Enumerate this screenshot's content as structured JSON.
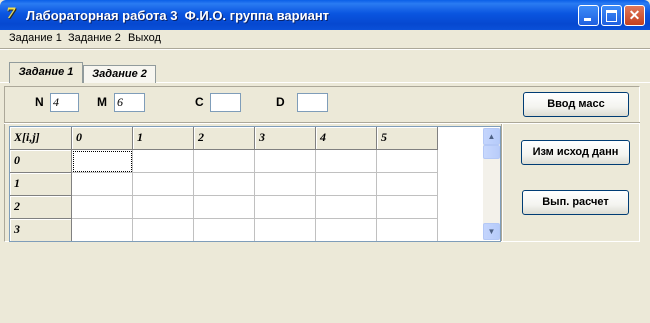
{
  "window": {
    "title": "Лабораторная работа 3  Ф.И.О. группа вариант",
    "controls": {
      "minimize": "minimize-icon",
      "maximize": "maximize-icon",
      "close": "close-icon"
    },
    "colors": {
      "titlebar": "#0a55e0",
      "face": "#ece9d8"
    }
  },
  "menu": {
    "items": [
      {
        "label": "Задание 1"
      },
      {
        "label": "Задание 2"
      },
      {
        "label": "Выход"
      }
    ]
  },
  "tabs": [
    {
      "label": "Задание 1",
      "active": true
    },
    {
      "label": "Задание 2",
      "active": false
    }
  ],
  "params": {
    "n": {
      "label": "N",
      "value": "4"
    },
    "m": {
      "label": "M",
      "value": "6"
    },
    "c": {
      "label": "C",
      "value": ""
    },
    "d": {
      "label": "D",
      "value": ""
    }
  },
  "buttons": {
    "input_array": "Ввод масс",
    "edit_source": "Изм исход данн",
    "compute": "Вып. расчет"
  },
  "grid": {
    "corner": "X[i,j]",
    "column_headers": [
      "0",
      "1",
      "2",
      "3",
      "4",
      "5"
    ],
    "row_headers": [
      "0",
      "1",
      "2",
      "3"
    ],
    "cells": [
      [
        "",
        "",
        "",
        "",
        "",
        ""
      ],
      [
        "",
        "",
        "",
        "",
        "",
        ""
      ],
      [
        "",
        "",
        "",
        "",
        "",
        ""
      ],
      [
        "",
        "",
        "",
        "",
        "",
        ""
      ]
    ]
  }
}
